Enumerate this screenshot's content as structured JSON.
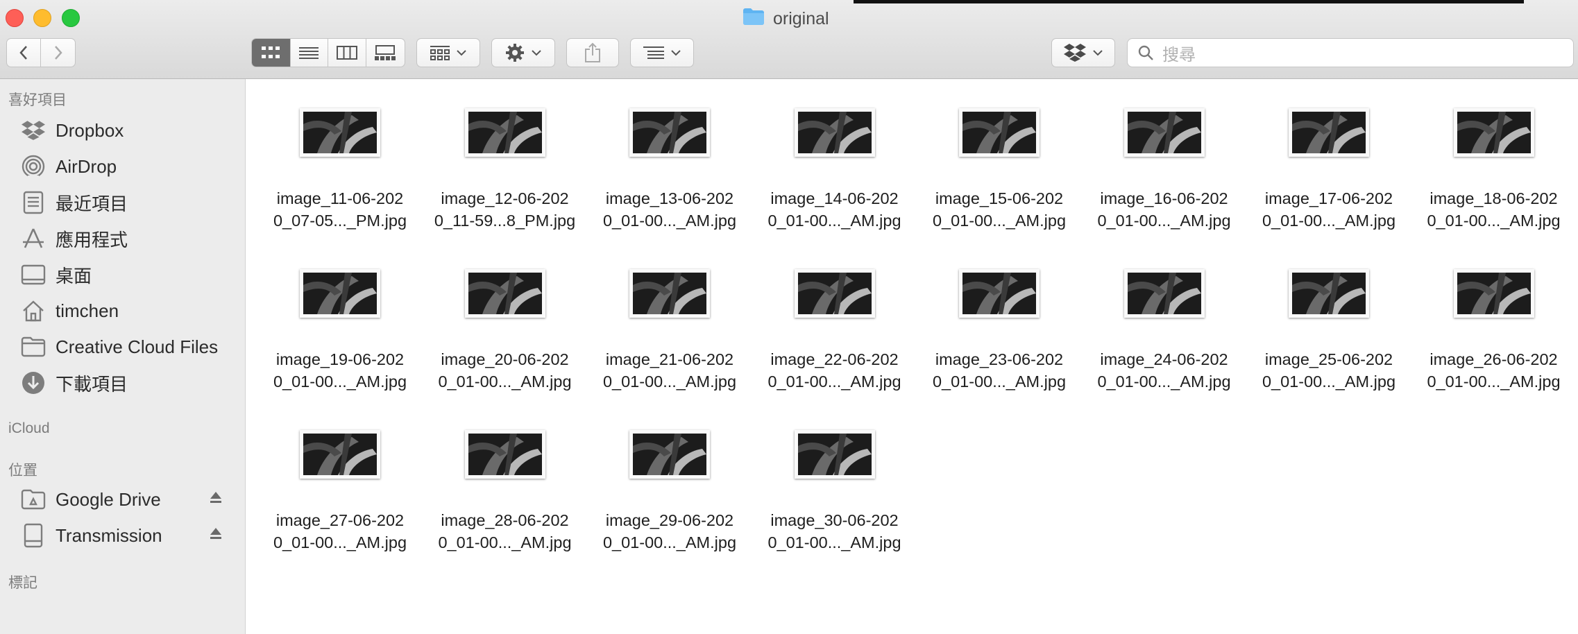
{
  "window": {
    "title": "original"
  },
  "toolbar": {
    "view_modes": [
      {
        "name": "view-icons-button",
        "icon": "grid-icon",
        "active": true
      },
      {
        "name": "view-list-button",
        "icon": "list-icon",
        "active": false
      },
      {
        "name": "view-columns-button",
        "icon": "columns-icon",
        "active": false
      },
      {
        "name": "view-gallery-button",
        "icon": "gallery-icon",
        "active": false
      }
    ],
    "search_placeholder": "搜尋"
  },
  "sidebar": {
    "favorites_header": "喜好項目",
    "favorites": [
      {
        "label": "Dropbox",
        "icon": "dropbox-icon"
      },
      {
        "label": "AirDrop",
        "icon": "airdrop-icon"
      },
      {
        "label": "最近項目",
        "icon": "recents-icon"
      },
      {
        "label": "應用程式",
        "icon": "applications-icon"
      },
      {
        "label": "桌面",
        "icon": "desktop-icon"
      },
      {
        "label": "timchen",
        "icon": "home-icon"
      },
      {
        "label": "Creative Cloud Files",
        "icon": "folder-icon"
      },
      {
        "label": "下載項目",
        "icon": "downloads-icon"
      }
    ],
    "icloud_header": "iCloud",
    "locations_header": "位置",
    "locations": [
      {
        "label": "Google Drive",
        "icon": "drive-icon",
        "eject": true
      },
      {
        "label": "Transmission",
        "icon": "disk-icon",
        "eject": true
      }
    ],
    "tags_header": "標記"
  },
  "files": [
    {
      "line1": "image_11-06-202",
      "line2": "0_07-05..._PM.jpg"
    },
    {
      "line1": "image_12-06-202",
      "line2": "0_11-59...8_PM.jpg"
    },
    {
      "line1": "image_13-06-202",
      "line2": "0_01-00..._AM.jpg"
    },
    {
      "line1": "image_14-06-202",
      "line2": "0_01-00..._AM.jpg"
    },
    {
      "line1": "image_15-06-202",
      "line2": "0_01-00..._AM.jpg"
    },
    {
      "line1": "image_16-06-202",
      "line2": "0_01-00..._AM.jpg"
    },
    {
      "line1": "image_17-06-202",
      "line2": "0_01-00..._AM.jpg"
    },
    {
      "line1": "image_18-06-202",
      "line2": "0_01-00..._AM.jpg"
    },
    {
      "line1": "image_19-06-202",
      "line2": "0_01-00..._AM.jpg"
    },
    {
      "line1": "image_20-06-202",
      "line2": "0_01-00..._AM.jpg"
    },
    {
      "line1": "image_21-06-202",
      "line2": "0_01-00..._AM.jpg"
    },
    {
      "line1": "image_22-06-202",
      "line2": "0_01-00..._AM.jpg"
    },
    {
      "line1": "image_23-06-202",
      "line2": "0_01-00..._AM.jpg"
    },
    {
      "line1": "image_24-06-202",
      "line2": "0_01-00..._AM.jpg"
    },
    {
      "line1": "image_25-06-202",
      "line2": "0_01-00..._AM.jpg"
    },
    {
      "line1": "image_26-06-202",
      "line2": "0_01-00..._AM.jpg"
    },
    {
      "line1": "image_27-06-202",
      "line2": "0_01-00..._AM.jpg"
    },
    {
      "line1": "image_28-06-202",
      "line2": "0_01-00..._AM.jpg"
    },
    {
      "line1": "image_29-06-202",
      "line2": "0_01-00..._AM.jpg"
    },
    {
      "line1": "image_30-06-202",
      "line2": "0_01-00..._AM.jpg"
    }
  ],
  "colors": {
    "close": "#fe5f57",
    "minimize": "#febc2e",
    "maximize": "#28c840",
    "sidebar_bg": "#ececec",
    "folder_blue": "#5fb4f2",
    "active_segment": "#6e6e6e"
  }
}
